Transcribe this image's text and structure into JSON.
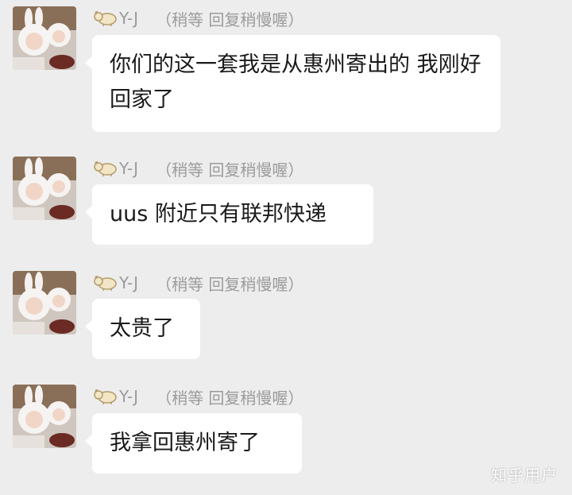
{
  "messages": [
    {
      "nickname": "Y-J",
      "status": "（稍等 回复稍慢喔）",
      "text": "你们的这一套我是从惠州寄出的 我刚好回家了"
    },
    {
      "nickname": "Y-J",
      "status": "（稍等 回复稍慢喔）",
      "text": "uus 附近只有联邦快递"
    },
    {
      "nickname": "Y-J",
      "status": "（稍等 回复稍慢喔）",
      "text": "太贵了"
    },
    {
      "nickname": "Y-J",
      "status": "（稍等 回复稍慢喔）",
      "text": "我拿回惠州寄了"
    }
  ],
  "watermark": "知乎用户",
  "colors": {
    "background": "#ededed",
    "bubble": "#ffffff",
    "nickname": "#9b9b9b",
    "text": "#1a1a1a"
  },
  "icons": {
    "nickname_prefix": "sheep-icon",
    "avatar": "avatar-photo"
  }
}
